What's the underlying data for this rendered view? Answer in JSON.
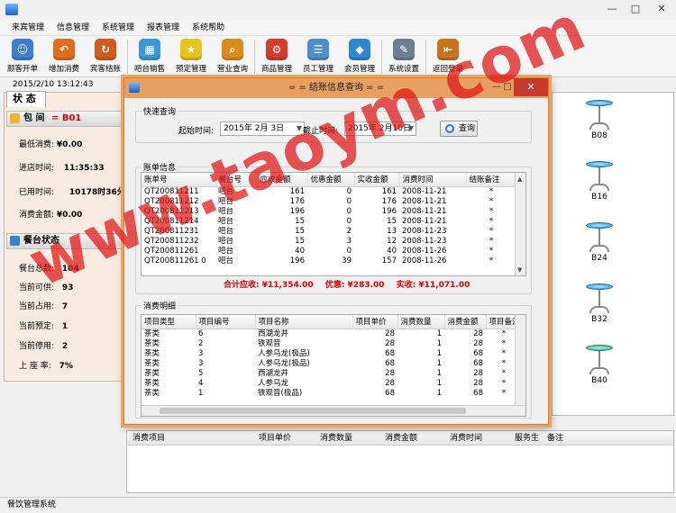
{
  "app": {
    "status_text": "餐饮管理系统"
  },
  "menu": [
    "来宾管理",
    "信息管理",
    "系统管理",
    "报表管理",
    "系统帮助"
  ],
  "toolbar": [
    {
      "label": "顾客开单",
      "icon": "customer-order-icon",
      "color": "#3f7fd1",
      "glyph": "☺"
    },
    {
      "label": "增加消费",
      "icon": "add-consume-icon",
      "color": "#e26b1e",
      "glyph": "↶"
    },
    {
      "label": "宾客结账",
      "icon": "checkout-icon",
      "color": "#d35a1a",
      "glyph": "↻"
    },
    {
      "label": "吧台销售",
      "icon": "bar-sales-icon",
      "color": "#3a9ad9",
      "glyph": "▦"
    },
    {
      "label": "预定管理",
      "icon": "reservation-icon",
      "color": "#e6c21c",
      "glyph": "★"
    },
    {
      "label": "营业查询",
      "icon": "business-query-icon",
      "color": "#d98b1c",
      "glyph": "⌕"
    },
    {
      "label": "商品管理",
      "icon": "goods-icon",
      "color": "#d83a2a",
      "glyph": "⚙"
    },
    {
      "label": "员工管理",
      "icon": "staff-icon",
      "color": "#4f8fc9",
      "glyph": "☰"
    },
    {
      "label": "会员管理",
      "icon": "member-icon",
      "color": "#2f86d2",
      "glyph": "◆"
    },
    {
      "label": "系统设置",
      "icon": "settings-icon",
      "color": "#6c7f93",
      "glyph": "✎"
    },
    {
      "label": "返回登录",
      "icon": "logout-icon",
      "color": "#c8741f",
      "glyph": "⇤"
    }
  ],
  "datetime": "2015/2/10   13:12:43",
  "left": {
    "tab": "状 态",
    "room_label": "包 间",
    "room_code": "= B01",
    "min_consume_label": "最低消费:",
    "min_consume": "¥0.00",
    "enter_time_label": "进店时间:",
    "enter_time": "11:35:33",
    "used_time_label": "已用时间:",
    "used_time": "10178时36分",
    "consume_label": "消费金额:",
    "consume": "¥0.00",
    "table_status": "餐台状态",
    "total_label": "餐台总数:",
    "total": "104",
    "avail_label": "当前可供:",
    "avail": "93",
    "occupied_label": "当前占用:",
    "occupied": "7",
    "reserved_label": "当前预定:",
    "reserved": "1",
    "stopped_label": "当前停用:",
    "stopped": "2",
    "rate_label": "上 座 率:",
    "rate": "7%"
  },
  "stools": [
    {
      "code": "B08",
      "color": "#1c8fd6"
    },
    {
      "code": "B16",
      "color": "#1c8fd6"
    },
    {
      "code": "B24",
      "color": "#1c8fd6"
    },
    {
      "code": "B32",
      "color": "#1c8fd6"
    },
    {
      "code": "B40",
      "color": "#42b14a"
    }
  ],
  "bottom_columns": [
    "消费项目",
    "项目单价",
    "消费数量",
    "消费金额",
    "消费时间",
    "服务生",
    "备注"
  ],
  "dialog": {
    "title": "= = 结账信息查询 = =",
    "quick_query": "快速查询",
    "start_label": "起始时间:",
    "start_value": "2015年 2月 3日",
    "end_label": "截止时间:",
    "end_value": "2015年 2月10日",
    "query_button": "查询",
    "bills_legend": "账单信息",
    "bill_columns": [
      "账单号",
      "餐台号",
      "应收金额",
      "优惠金额",
      "实收金额",
      "消费时间",
      "结账备注"
    ],
    "bills": [
      [
        "QT200811211",
        "吧台",
        "161",
        "0",
        "161",
        "2008-11-21",
        "*"
      ],
      [
        "QT200811212",
        "吧台",
        "176",
        "0",
        "176",
        "2008-11-21",
        "*"
      ],
      [
        "QT200811213",
        "吧台",
        "196",
        "0",
        "196",
        "2008-11-21",
        "*"
      ],
      [
        "QT200811214",
        "吧台",
        "15",
        "0",
        "15",
        "2008-11-21",
        "*"
      ],
      [
        "QT200811231",
        "吧台",
        "15",
        "2",
        "13",
        "2008-11-23",
        "*"
      ],
      [
        "QT200811232",
        "吧台",
        "15",
        "3",
        "12",
        "2008-11-23",
        "*"
      ],
      [
        "QT200811261",
        "吧台",
        "40",
        "0",
        "40",
        "2008-11-26",
        "*"
      ],
      [
        "QT200811261 0",
        "吧台",
        "196",
        "39",
        "157",
        "2008-11-26",
        "*"
      ]
    ],
    "summary_receivable": "合计应收: ¥11,354.00",
    "summary_discount": "优惠: ¥283.00",
    "summary_received": "实收: ¥11,071.00",
    "detail_legend": "消费明细",
    "detail_columns": [
      "项目类型",
      "项目编号",
      "项目名称",
      "项目单价",
      "消费数量",
      "消费金额",
      "项目备注"
    ],
    "details": [
      [
        "茶类",
        "6",
        "西湖龙井",
        "28",
        "1",
        "28",
        "*"
      ],
      [
        "茶类",
        "2",
        "铁观音",
        "28",
        "1",
        "28",
        "*"
      ],
      [
        "茶类",
        "3",
        "人参乌龙(极品)",
        "68",
        "1",
        "68",
        "*"
      ],
      [
        "茶类",
        "3",
        "人参乌龙(极品)",
        "68",
        "1",
        "68",
        "*"
      ],
      [
        "茶类",
        "5",
        "西湖龙井",
        "28",
        "1",
        "28",
        "*"
      ],
      [
        "茶类",
        "4",
        "人参乌龙",
        "28",
        "1",
        "28",
        "*"
      ],
      [
        "茶类",
        "1",
        "铁观音(极品)",
        "68",
        "1",
        "68",
        "*"
      ]
    ]
  },
  "watermark": "www.taoym.com"
}
